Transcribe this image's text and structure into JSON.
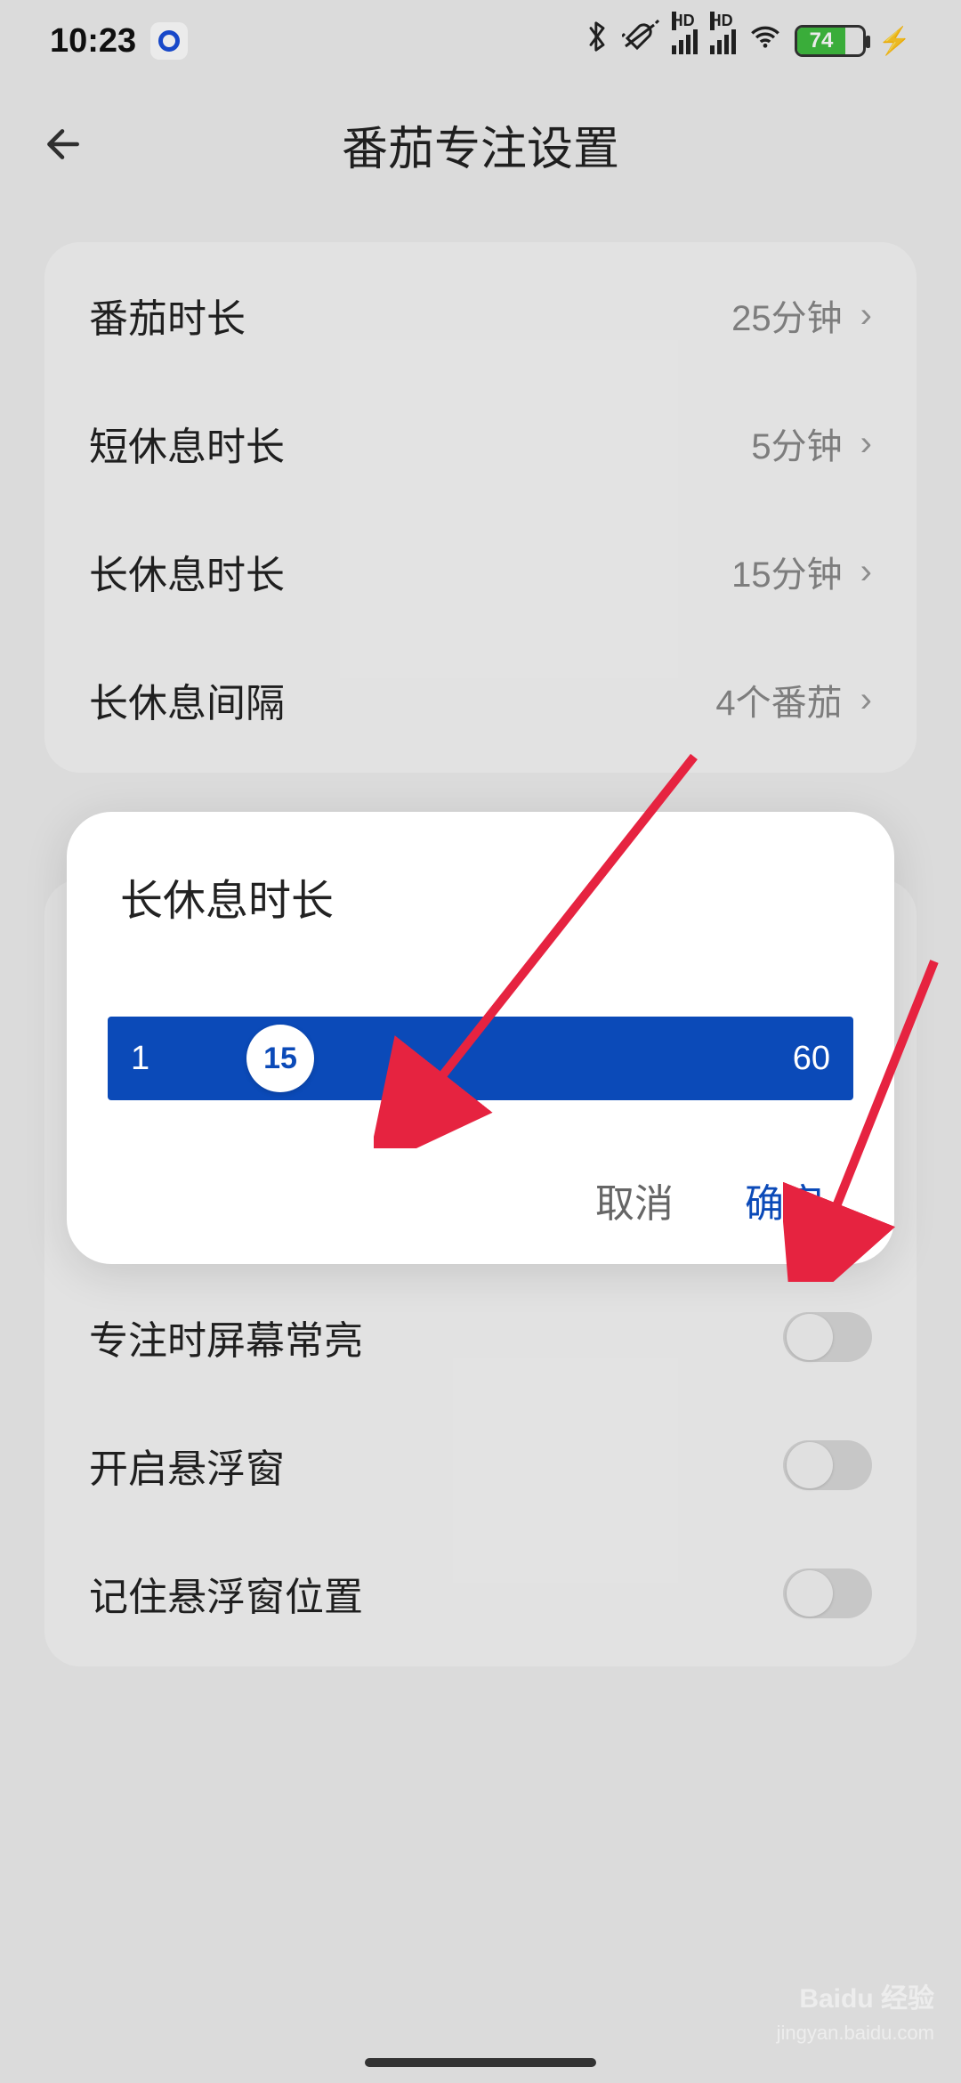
{
  "status": {
    "time": "10:23",
    "battery_pct": "74",
    "hd_label": "HD"
  },
  "header": {
    "title": "番茄专注设置"
  },
  "settings_group1": [
    {
      "label": "番茄时长",
      "value": "25分钟"
    },
    {
      "label": "短休息时长",
      "value": "5分钟"
    },
    {
      "label": "长休息时长",
      "value": "15分钟"
    },
    {
      "label": "长休息间隔",
      "value": "4个番茄"
    }
  ],
  "settings_group2": [
    {
      "label": "专注时屏幕常亮"
    },
    {
      "label": "开启悬浮窗"
    },
    {
      "label": "记住悬浮窗位置"
    }
  ],
  "dialog": {
    "title": "长休息时长",
    "min": "1",
    "max": "60",
    "value": "15",
    "cancel_label": "取消",
    "ok_label": "确定"
  },
  "watermark": {
    "brand": "Baidu 经验",
    "url": "jingyan.baidu.com"
  },
  "colors": {
    "accent": "#0b4ab8",
    "arrow": "#e62340"
  }
}
